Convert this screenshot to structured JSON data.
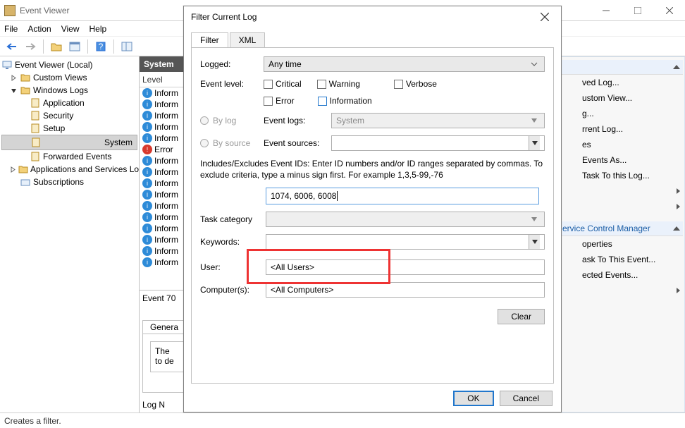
{
  "window": {
    "title": "Event Viewer"
  },
  "menu": {
    "file": "File",
    "action": "Action",
    "view": "View",
    "help": "Help"
  },
  "tree": {
    "root": "Event Viewer (Local)",
    "custom": "Custom Views",
    "winlogs": "Windows Logs",
    "app": "Application",
    "sec": "Security",
    "setup": "Setup",
    "sys": "System",
    "fwd": "Forwarded Events",
    "asl": "Applications and Services Lo",
    "subs": "Subscriptions"
  },
  "mid": {
    "header": "System",
    "col0": "Level",
    "details_prefix": "Event 70",
    "tab_general": "Genera",
    "box_line1": "The",
    "box_line2": "to de",
    "logn": "Log N"
  },
  "events": [
    {
      "t": "info",
      "l": "Inform"
    },
    {
      "t": "info",
      "l": "Inform"
    },
    {
      "t": "info",
      "l": "Inform"
    },
    {
      "t": "info",
      "l": "Inform"
    },
    {
      "t": "info",
      "l": "Inform"
    },
    {
      "t": "err",
      "l": "Error"
    },
    {
      "t": "info",
      "l": "Inform"
    },
    {
      "t": "info",
      "l": "Inform"
    },
    {
      "t": "info",
      "l": "Inform"
    },
    {
      "t": "info",
      "l": "Inform"
    },
    {
      "t": "info",
      "l": "Inform"
    },
    {
      "t": "info",
      "l": "Inform"
    },
    {
      "t": "info",
      "l": "Inform"
    },
    {
      "t": "info",
      "l": "Inform"
    },
    {
      "t": "info",
      "l": "Inform"
    },
    {
      "t": "info",
      "l": "Inform"
    }
  ],
  "actions": {
    "items": [
      "ved Log...",
      "ustom View...",
      "g...",
      "rrent Log...",
      "es",
      "Events As...",
      "Task To this Log..."
    ],
    "grp": "ervice Control Manager",
    "items2": [
      "operties",
      "ask To This Event...",
      "ected Events..."
    ]
  },
  "status": "Creates a filter.",
  "dialog": {
    "title": "Filter Current Log",
    "tab_filter": "Filter",
    "tab_xml": "XML",
    "logged": "Logged:",
    "logged_val": "Any time",
    "level": "Event level:",
    "lv_crit": "Critical",
    "lv_warn": "Warning",
    "lv_verb": "Verbose",
    "lv_err": "Error",
    "lv_info": "Information",
    "bylog": "By log",
    "bysource": "By source",
    "evlogs": "Event logs:",
    "evlogs_val": "System",
    "evsrc": "Event sources:",
    "help": "Includes/Excludes Event IDs: Enter ID numbers and/or ID ranges separated by commas. To exclude criteria, type a minus sign first. For example 1,3,5-99,-76",
    "ids": "1074, 6006, 6008",
    "task": "Task category",
    "keywords": "Keywords:",
    "user": "User:",
    "user_val": "<All Users>",
    "comp": "Computer(s):",
    "comp_val": "<All Computers>",
    "clear": "Clear",
    "ok": "OK",
    "cancel": "Cancel"
  }
}
